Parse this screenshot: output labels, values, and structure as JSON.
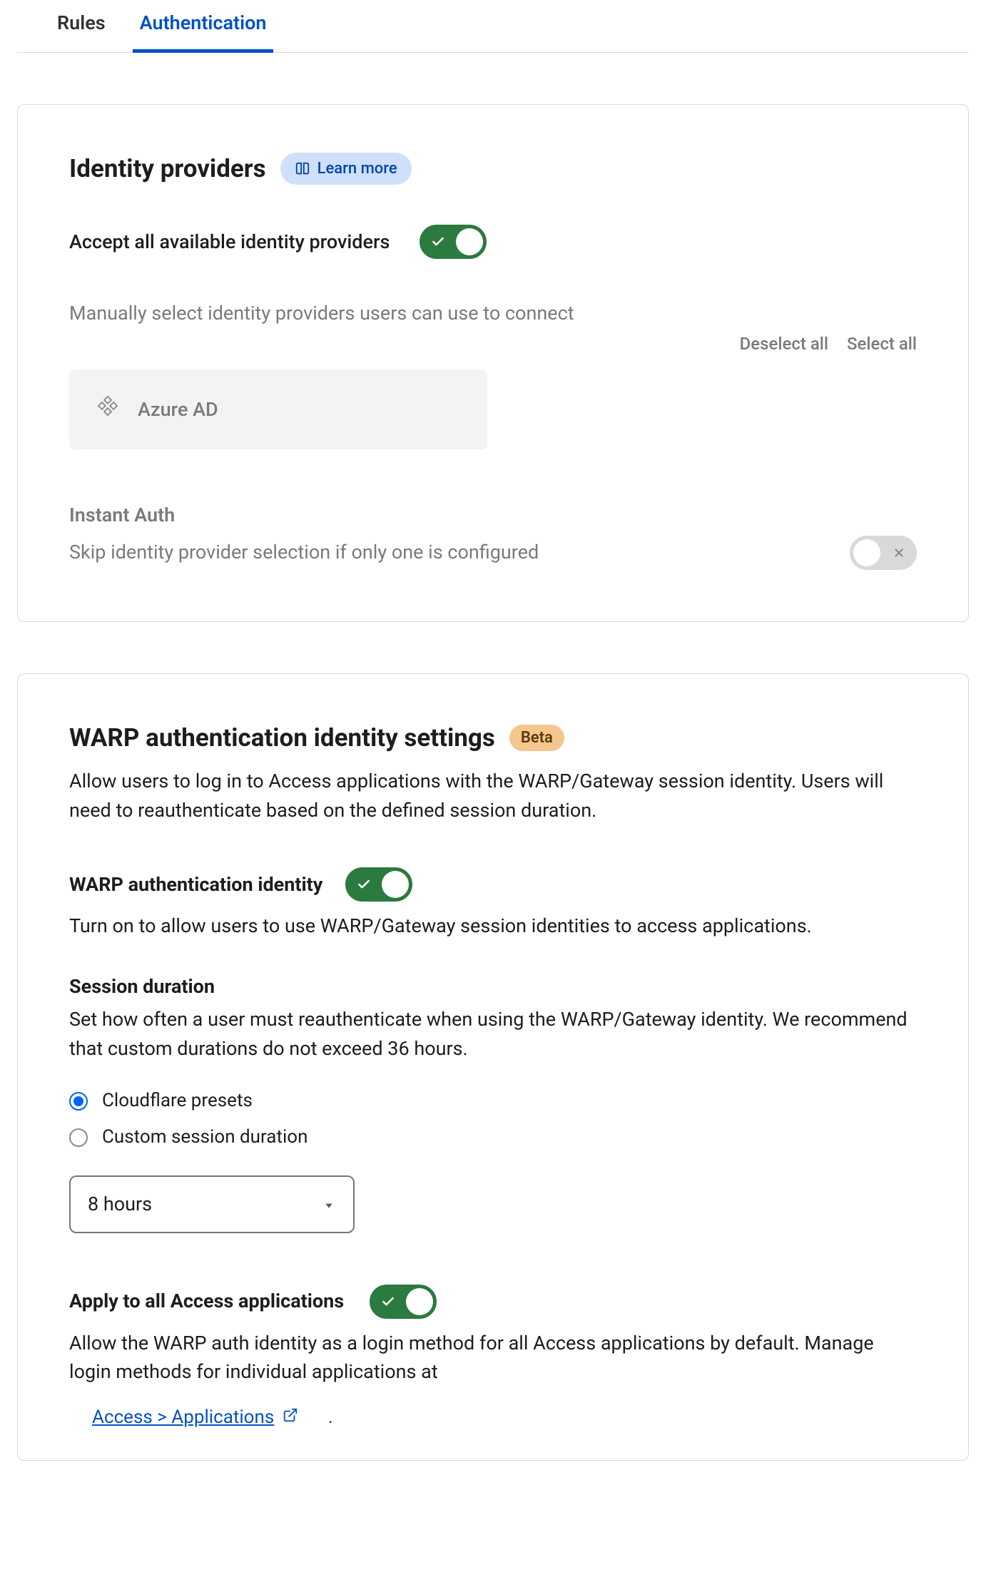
{
  "tabs": {
    "rules": "Rules",
    "authentication": "Authentication"
  },
  "identity": {
    "title": "Identity providers",
    "learn_more": "Learn more",
    "accept_all_label": "Accept all available identity providers",
    "manual_select_desc": "Manually select identity providers users can use to connect",
    "deselect_all": "Deselect all",
    "select_all": "Select all",
    "provider_name": "Azure AD",
    "instant_auth_title": "Instant Auth",
    "instant_auth_desc": "Skip identity provider selection if only one is configured"
  },
  "warp": {
    "title": "WARP authentication identity settings",
    "badge": "Beta",
    "description": "Allow users to log in to Access applications with the WARP/Gateway session identity. Users will need to reauthenticate based on the defined session duration.",
    "toggle_label": "WARP authentication identity",
    "toggle_desc": "Turn on to allow users to use WARP/Gateway session identities to access applications.",
    "session_title": "Session duration",
    "session_desc": "Set how often a user must reauthenticate when using the WARP/Gateway identity. We recommend that custom durations do not exceed 36 hours.",
    "radio_presets": "Cloudflare presets",
    "radio_custom": "Custom session duration",
    "duration_value": "8 hours",
    "apply_all_label": "Apply to all Access applications",
    "apply_all_desc": "Allow the WARP auth identity as a login method for all Access applications by default. Manage login methods for individual applications at",
    "link_text": "Access > Applications",
    "period": "."
  }
}
